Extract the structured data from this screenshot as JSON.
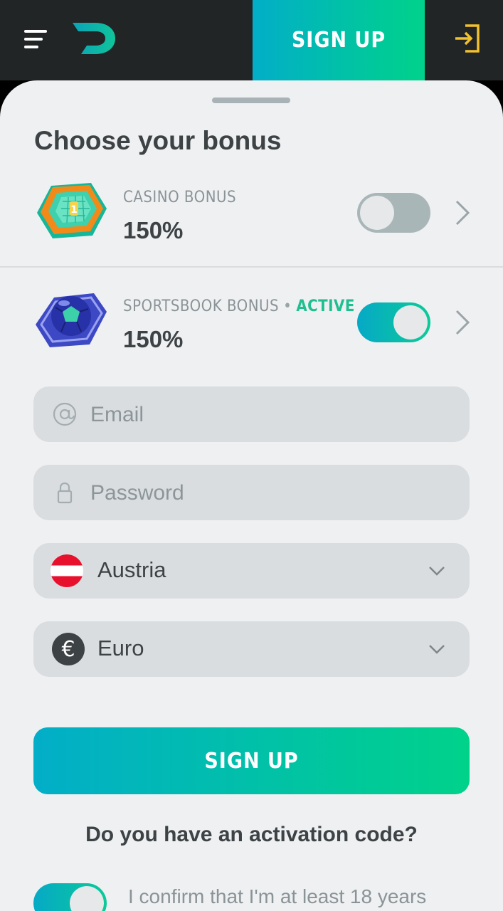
{
  "header": {
    "signup_label": "SIGN UP",
    "menu_icon": "hamburger-menu-icon",
    "logo": "brand-logo-d",
    "login_icon": "login-icon",
    "accent_color": "#f2c12e"
  },
  "bonus_section": {
    "title": "Choose your bonus",
    "items": [
      {
        "kind": "CASINO BONUS",
        "status": "",
        "value": "150%",
        "enabled": false,
        "icon": "casino-hexagon-icon"
      },
      {
        "kind": "SPORTSBOOK BONUS",
        "status": "ACTIVE",
        "value": "150%",
        "enabled": true,
        "icon": "soccer-ball-hexagon-icon"
      }
    ]
  },
  "form": {
    "email_placeholder": "Email",
    "password_placeholder": "Password",
    "country": "Austria",
    "currency": "Euro",
    "submit_label": "SIGN UP",
    "activation_prompt": "Do you have an activation code?",
    "age_confirm_text": "I confirm that I'm at least 18 years",
    "age_confirm_enabled": true
  },
  "colors": {
    "gradient_start": "#02aec8",
    "gradient_end": "#00d28a",
    "active_status": "#1fbf8f"
  }
}
